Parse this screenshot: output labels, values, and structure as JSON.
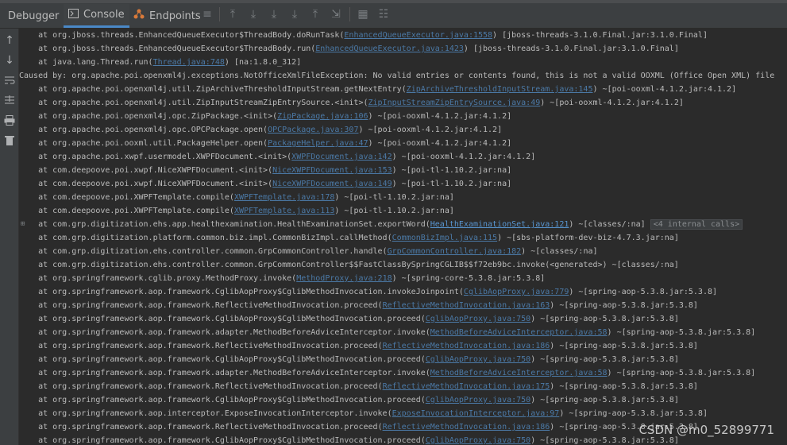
{
  "tabs": [
    {
      "label": "Debugger",
      "icon": "debugger-icon"
    },
    {
      "label": "Console",
      "icon": "console-icon"
    },
    {
      "label": "Endpoints",
      "icon": "endpoints-icon"
    }
  ],
  "console_lines": [
    {
      "pre": "    at org.jboss.threads.EnhancedQueueExecutor$ThreadBody.doRunTask(",
      "link": "EnhancedQueueExecutor.java:1558",
      "post": ") [jboss-threads-3.1.0.Final.jar:3.1.0.Final]"
    },
    {
      "pre": "    at org.jboss.threads.EnhancedQueueExecutor$ThreadBody.run(",
      "link": "EnhancedQueueExecutor.java:1423",
      "post": ") [jboss-threads-3.1.0.Final.jar:3.1.0.Final]"
    },
    {
      "pre": "    at java.lang.Thread.run(",
      "link": "Thread.java:748",
      "post": ") [na:1.8.0_312]"
    },
    {
      "pre": "Caused by: org.apache.poi.openxml4j.exceptions.NotOfficeXmlFileException: No valid entries or contents found, this is not a valid OOXML (Office Open XML) file",
      "link": "",
      "post": ""
    },
    {
      "pre": "    at org.apache.poi.openxml4j.util.ZipArchiveThresholdInputStream.getNextEntry(",
      "link": "ZipArchiveThresholdInputStream.java:145",
      "post": ") ~[poi-ooxml-4.1.2.jar:4.1.2]"
    },
    {
      "pre": "    at org.apache.poi.openxml4j.util.ZipInputStreamZipEntrySource.<init>(",
      "link": "ZipInputStreamZipEntrySource.java:49",
      "post": ") ~[poi-ooxml-4.1.2.jar:4.1.2]"
    },
    {
      "pre": "    at org.apache.poi.openxml4j.opc.ZipPackage.<init>(",
      "link": "ZipPackage.java:106",
      "post": ") ~[poi-ooxml-4.1.2.jar:4.1.2]"
    },
    {
      "pre": "    at org.apache.poi.openxml4j.opc.OPCPackage.open(",
      "link": "OPCPackage.java:307",
      "post": ") ~[poi-ooxml-4.1.2.jar:4.1.2]"
    },
    {
      "pre": "    at org.apache.poi.ooxml.util.PackageHelper.open(",
      "link": "PackageHelper.java:47",
      "post": ") ~[poi-ooxml-4.1.2.jar:4.1.2]"
    },
    {
      "pre": "    at org.apache.poi.xwpf.usermodel.XWPFDocument.<init>(",
      "link": "XWPFDocument.java:142",
      "post": ") ~[poi-ooxml-4.1.2.jar:4.1.2]"
    },
    {
      "pre": "    at com.deepoove.poi.xwpf.NiceXWPFDocument.<init>(",
      "link": "NiceXWPFDocument.java:153",
      "post": ") ~[poi-tl-1.10.2.jar:na]"
    },
    {
      "pre": "    at com.deepoove.poi.xwpf.NiceXWPFDocument.<init>(",
      "link": "NiceXWPFDocument.java:149",
      "post": ") ~[poi-tl-1.10.2.jar:na]"
    },
    {
      "pre": "    at com.deepoove.poi.XWPFTemplate.compile(",
      "link": "XWPFTemplate.java:178",
      "post": ") ~[poi-tl-1.10.2.jar:na]"
    },
    {
      "pre": "    at com.deepoove.poi.XWPFTemplate.compile(",
      "link": "XWPFTemplate.java:113",
      "post": ") ~[poi-tl-1.10.2.jar:na]"
    },
    {
      "pre": "    at com.grp.digitization.ehs.app.healthexamination.HealthExaminationSet.exportWord(",
      "link": "HealthExaminationSet.java:121",
      "post": ") ~[classes/:na] ",
      "badge": "<4 internal calls>",
      "fold": true
    },
    {
      "pre": "    at com.grp.digitization.platform.common.biz.impl.CommonBizImpl.callMethod(",
      "link": "CommonBizImpl.java:115",
      "post": ") ~[sbs-platform-dev-biz-4.7.3.jar:na]"
    },
    {
      "pre": "    at com.grp.digitization.ehs.controller.common.GrpCommonController.handle(",
      "link": "GrpCommonController.java:182",
      "post": ") ~[classes/:na]"
    },
    {
      "pre": "    at com.grp.digitization.ehs.controller.common.GrpCommonController$$FastClassBySpringCGLIB$$f72eb9bc.invoke(<generated>) ~[classes/:na]",
      "link": "",
      "post": ""
    },
    {
      "pre": "    at org.springframework.cglib.proxy.MethodProxy.invoke(",
      "link": "MethodProxy.java:218",
      "post": ") ~[spring-core-5.3.8.jar:5.3.8]"
    },
    {
      "pre": "    at org.springframework.aop.framework.CglibAopProxy$CglibMethodInvocation.invokeJoinpoint(",
      "link": "CglibAopProxy.java:779",
      "post": ") ~[spring-aop-5.3.8.jar:5.3.8]"
    },
    {
      "pre": "    at org.springframework.aop.framework.ReflectiveMethodInvocation.proceed(",
      "link": "ReflectiveMethodInvocation.java:163",
      "post": ") ~[spring-aop-5.3.8.jar:5.3.8]"
    },
    {
      "pre": "    at org.springframework.aop.framework.CglibAopProxy$CglibMethodInvocation.proceed(",
      "link": "CglibAopProxy.java:750",
      "post": ") ~[spring-aop-5.3.8.jar:5.3.8]"
    },
    {
      "pre": "    at org.springframework.aop.framework.adapter.MethodBeforeAdviceInterceptor.invoke(",
      "link": "MethodBeforeAdviceInterceptor.java:58",
      "post": ") ~[spring-aop-5.3.8.jar:5.3.8]"
    },
    {
      "pre": "    at org.springframework.aop.framework.ReflectiveMethodInvocation.proceed(",
      "link": "ReflectiveMethodInvocation.java:186",
      "post": ") ~[spring-aop-5.3.8.jar:5.3.8]"
    },
    {
      "pre": "    at org.springframework.aop.framework.CglibAopProxy$CglibMethodInvocation.proceed(",
      "link": "CglibAopProxy.java:750",
      "post": ") ~[spring-aop-5.3.8.jar:5.3.8]"
    },
    {
      "pre": "    at org.springframework.aop.framework.adapter.MethodBeforeAdviceInterceptor.invoke(",
      "link": "MethodBeforeAdviceInterceptor.java:58",
      "post": ") ~[spring-aop-5.3.8.jar:5.3.8]"
    },
    {
      "pre": "    at org.springframework.aop.framework.ReflectiveMethodInvocation.proceed(",
      "link": "ReflectiveMethodInvocation.java:175",
      "post": ") ~[spring-aop-5.3.8.jar:5.3.8]"
    },
    {
      "pre": "    at org.springframework.aop.framework.CglibAopProxy$CglibMethodInvocation.proceed(",
      "link": "CglibAopProxy.java:750",
      "post": ") ~[spring-aop-5.3.8.jar:5.3.8]"
    },
    {
      "pre": "    at org.springframework.aop.interceptor.ExposeInvocationInterceptor.invoke(",
      "link": "ExposeInvocationInterceptor.java:97",
      "post": ") ~[spring-aop-5.3.8.jar:5.3.8]"
    },
    {
      "pre": "    at org.springframework.aop.framework.ReflectiveMethodInvocation.proceed(",
      "link": "ReflectiveMethodInvocation.java:186",
      "post": ") ~[spring-aop-5.3.8.jar:5.3.8]"
    },
    {
      "pre": "    at org.springframework.aop.framework.CglibAopProxy$CglibMethodInvocation.proceed(",
      "link": "CglibAopProxy.java:750",
      "post": ") ~[spring-aop-5.3.8.jar:5.3.8]"
    }
  ],
  "watermark": "CSDN @m0_52899771",
  "colors": {
    "link": "#4b79a6",
    "text": "#bbbbbb",
    "background": "#2b2b2b",
    "active_tab_underline": "#4a88c7"
  }
}
